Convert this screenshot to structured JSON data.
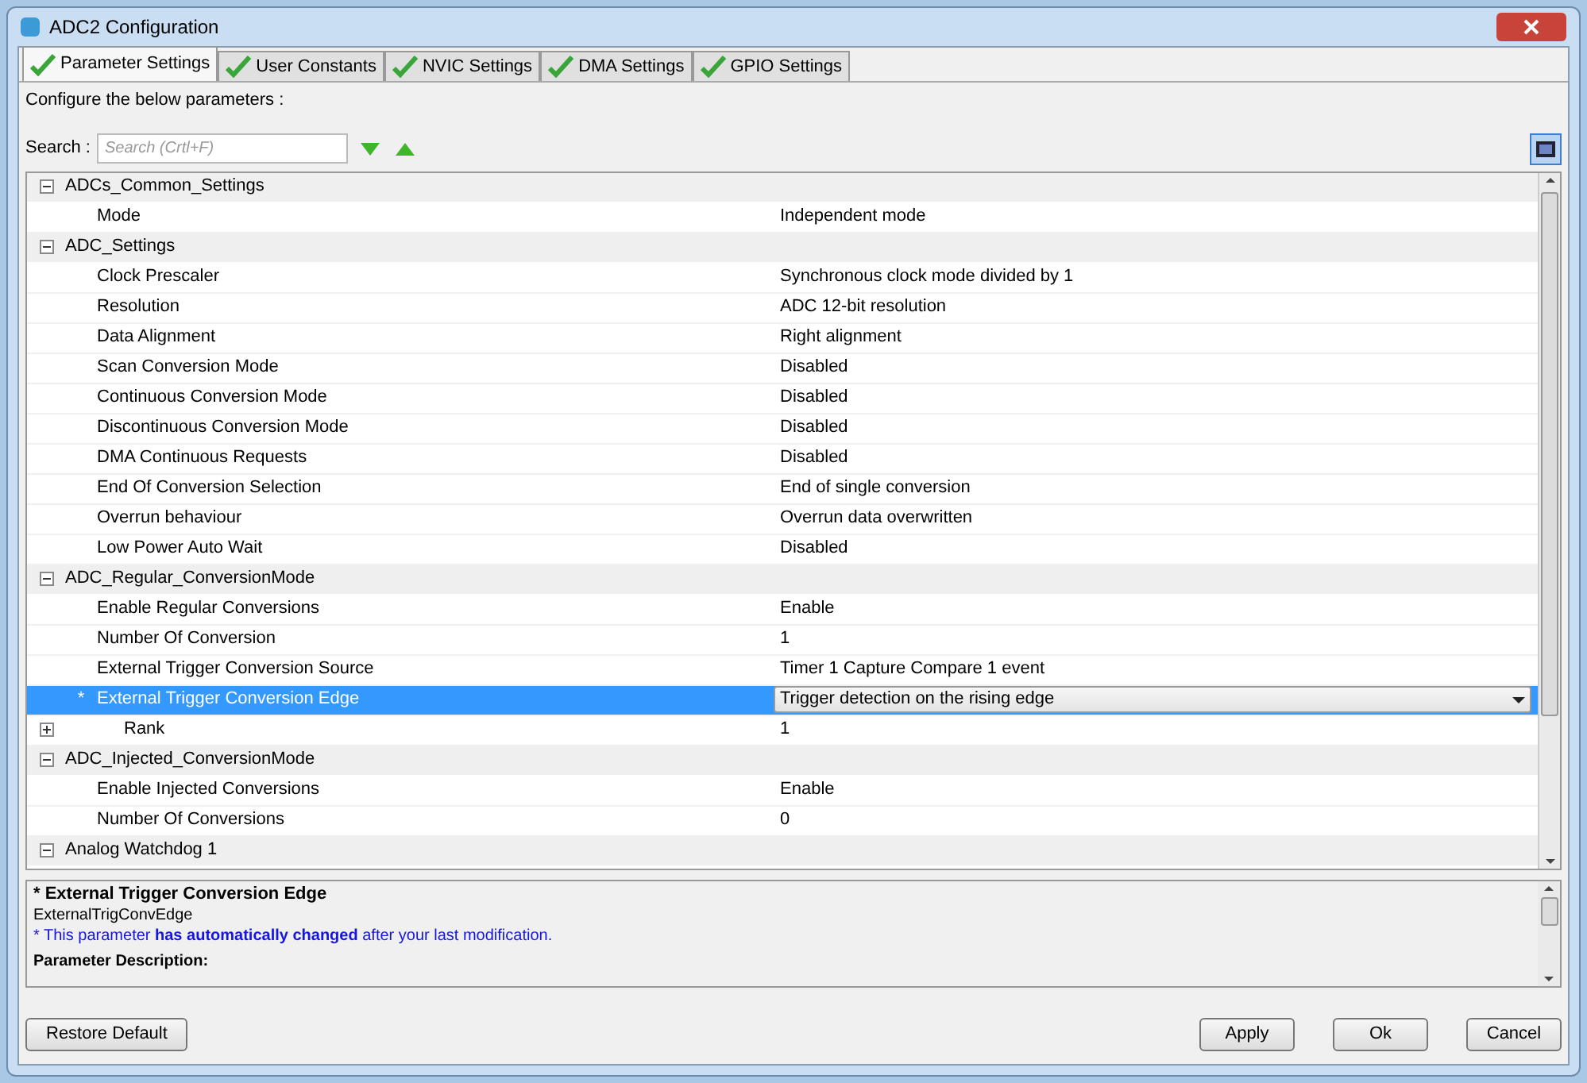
{
  "window": {
    "title": "ADC2 Configuration"
  },
  "tabs": [
    {
      "label": "Parameter Settings",
      "selected": true
    },
    {
      "label": "User Constants",
      "selected": false
    },
    {
      "label": "NVIC Settings",
      "selected": false
    },
    {
      "label": "DMA Settings",
      "selected": false
    },
    {
      "label": "GPIO Settings",
      "selected": false
    }
  ],
  "intro": "Configure the below parameters :",
  "search": {
    "label": "Search :",
    "placeholder": "Search (Crtl+F)"
  },
  "groups": [
    {
      "name": "ADCs_Common_Settings",
      "expanded": true,
      "children": [
        {
          "name": "Mode",
          "value": "Independent mode",
          "selected": false
        }
      ]
    },
    {
      "name": "ADC_Settings",
      "expanded": true,
      "children": [
        {
          "name": "Clock Prescaler",
          "value": "Synchronous clock mode divided by 1",
          "selected": false
        },
        {
          "name": "Resolution",
          "value": "ADC 12-bit resolution",
          "selected": false
        },
        {
          "name": "Data Alignment",
          "value": "Right alignment",
          "selected": false
        },
        {
          "name": "Scan Conversion Mode",
          "value": "Disabled",
          "selected": false
        },
        {
          "name": "Continuous Conversion Mode",
          "value": "Disabled",
          "selected": false
        },
        {
          "name": "Discontinuous Conversion Mode",
          "value": "Disabled",
          "selected": false
        },
        {
          "name": "DMA Continuous Requests",
          "value": "Disabled",
          "selected": false
        },
        {
          "name": "End Of Conversion Selection",
          "value": "End of single conversion",
          "selected": false
        },
        {
          "name": "Overrun behaviour",
          "value": "Overrun data overwritten",
          "selected": false
        },
        {
          "name": "Low Power Auto Wait",
          "value": "Disabled",
          "selected": false
        }
      ]
    },
    {
      "name": "ADC_Regular_ConversionMode",
      "expanded": true,
      "children": [
        {
          "name": "Enable Regular Conversions",
          "value": "Enable",
          "selected": false
        },
        {
          "name": "Number Of Conversion",
          "value": "1",
          "selected": false
        },
        {
          "name": "External Trigger Conversion Source",
          "value": "Timer 1 Capture Compare 1 event",
          "selected": false
        },
        {
          "name": "External Trigger Conversion Edge",
          "value": "Trigger detection on the rising edge",
          "kind": "dropdown",
          "selected": true,
          "marker": "*"
        },
        {
          "name": "Rank",
          "value": "1",
          "selected": false,
          "expanded": false
        }
      ]
    },
    {
      "name": "ADC_Injected_ConversionMode",
      "expanded": true,
      "children": [
        {
          "name": "Enable Injected Conversions",
          "value": "Enable",
          "selected": false
        },
        {
          "name": "Number Of Conversions",
          "value": "0",
          "selected": false
        }
      ]
    },
    {
      "name": "Analog Watchdog 1",
      "expanded": true
    }
  ],
  "description": {
    "title": "* External Trigger Conversion Edge",
    "param": "ExternalTrigConvEdge",
    "note": "* This parameter **has automatically changed** after your last modification.",
    "heading": "Parameter Description:"
  },
  "buttons": {
    "left": "Restore Default",
    "right": [
      "Apply",
      "Ok",
      "Cancel"
    ]
  }
}
